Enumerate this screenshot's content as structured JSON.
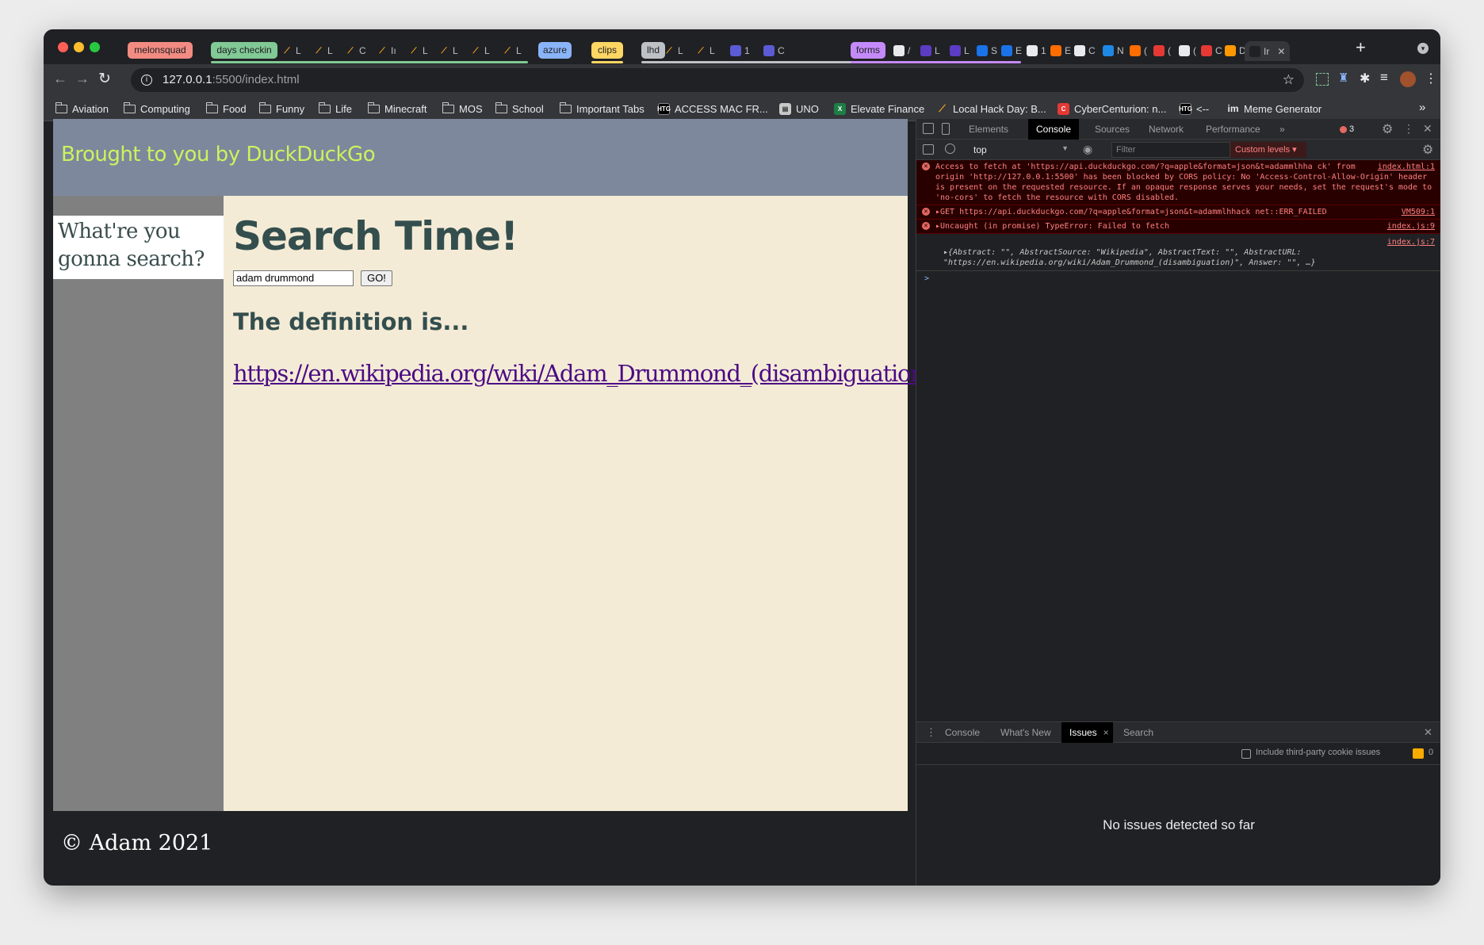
{
  "tab_groups": [
    {
      "label": "melonsquad",
      "color": "#f28b82"
    },
    {
      "label": "days checkin",
      "color": "#81c995"
    },
    {
      "label": "azure",
      "color": "#8ab4f8"
    },
    {
      "label": "clips",
      "color": "#fdd663"
    },
    {
      "label": "lhd",
      "color": "#bdc1c6"
    },
    {
      "label": "forms",
      "color": "#c58af9"
    }
  ],
  "tab_letters": [
    "L",
    "L",
    "C",
    "Iı",
    "L",
    "L",
    "L",
    "L",
    "L",
    "L",
    "1",
    "C",
    "/",
    "L",
    "L",
    "S",
    "E",
    "1",
    "E",
    "C",
    "N",
    "(",
    "(",
    "(",
    "C",
    "D",
    "Ir"
  ],
  "active_tab_title": "Ir",
  "url": {
    "host": "127.0.0.1",
    "rest": ":5500/index.html"
  },
  "bookmarks": [
    "Aviation",
    "Computing",
    "Food",
    "Funny",
    "Life",
    "Minecraft",
    "MOS",
    "School",
    "Important Tabs",
    "ACCESS MAC FR...",
    "UNO",
    "Elevate Finance",
    "Local Hack Day: B...",
    "CyberCenturion: n...",
    "<--",
    "Meme Generator"
  ],
  "page": {
    "header": "Brought to you by DuckDuckGo",
    "sidebar_text": "What're you gonna search?",
    "title": "Search Time!",
    "query": "adam drummond",
    "go_label": "GO!",
    "definition_heading": "The definition is...",
    "result_link": "https://en.wikipedia.org/wiki/Adam_Drummond_(disambiguation)",
    "footer": "© Adam 2021"
  },
  "devtools": {
    "tabs": [
      "Elements",
      "Console",
      "Sources",
      "Network",
      "Performance"
    ],
    "active_tab": "Console",
    "error_count": "3",
    "context": "top",
    "filter_placeholder": "Filter",
    "levels": "Custom levels",
    "errors": [
      {
        "text": "Access to fetch at 'https://api.duckduckgo.com/?q=apple&format=json&t=adammlhha ck' from origin 'http://127.0.0.1:5500' has been blocked by CORS policy: No 'Access-Control-Allow-Origin' header is present on the requested resource. If an opaque response serves your needs, set the request's mode to 'no-cors' to fetch the resource with CORS disabled.",
        "src": "index.html:1"
      },
      {
        "text": "▸GET https://api.duckduckgo.com/?q=apple&format=json&t=adammlhhack net::ERR_FAILED",
        "src": "VM509:1"
      },
      {
        "text": "▸Uncaught (in promise) TypeError: Failed to fetch",
        "src": "index.js:9"
      }
    ],
    "log_src": "index.js:7",
    "log_text": "▸{Abstract: \"\", AbstractSource: \"Wikipedia\", AbstractText: \"\", AbstractURL: \"https://en.wikipedia.org/wiki/Adam_Drummond_(disambiguation)\", Answer: \"\", …}",
    "prompt": ">",
    "drawer_tabs": [
      "Console",
      "What's New",
      "Issues",
      "Search"
    ],
    "drawer_active": "Issues",
    "third_party_label": "Include third-party cookie issues",
    "issues_count": "0",
    "no_issues": "No issues detected so far"
  }
}
